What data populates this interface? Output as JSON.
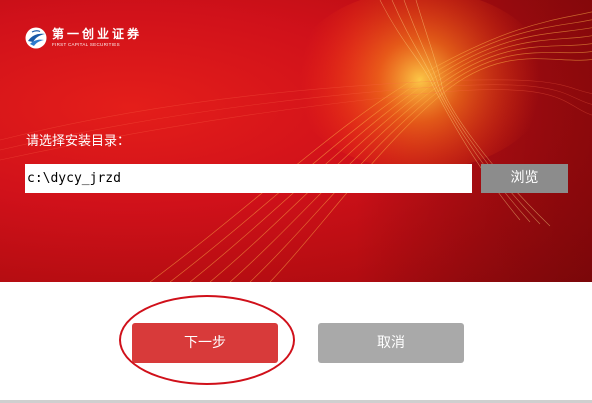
{
  "brand": {
    "name_cn": "第一创业证券",
    "name_en": "FIRST CAPITAL SECURITIES",
    "logo_icon": "eagle-globe-icon"
  },
  "install": {
    "directory_label": "请选择安装目录：",
    "directory_value": "c:\\dycy_jrzd",
    "browse_label": "浏览"
  },
  "actions": {
    "next_label": "下一步",
    "cancel_label": "取消"
  },
  "colors": {
    "banner_red": "#d0111a",
    "next_button": "#d83a3a",
    "cancel_button": "#a9a9a9",
    "browse_button": "#8c8c8c",
    "highlight_ring": "#d0101a"
  }
}
